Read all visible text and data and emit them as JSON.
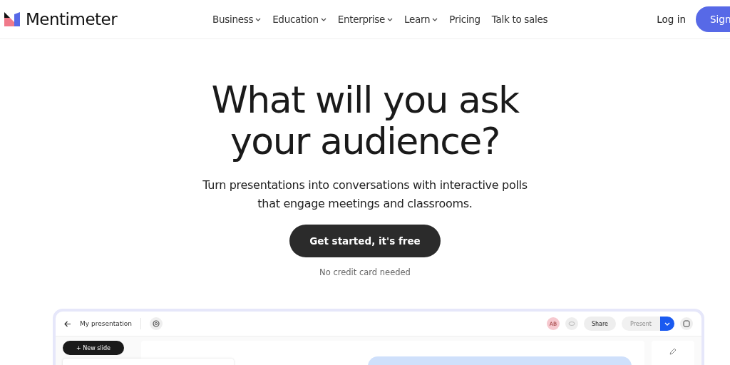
{
  "brand": {
    "name": "Mentimeter"
  },
  "nav": [
    {
      "label": "Business",
      "dropdown": true
    },
    {
      "label": "Education",
      "dropdown": true
    },
    {
      "label": "Enterprise",
      "dropdown": true
    },
    {
      "label": "Learn",
      "dropdown": true
    },
    {
      "label": "Pricing",
      "dropdown": false
    },
    {
      "label": "Talk to sales",
      "dropdown": false
    }
  ],
  "login": "Log in",
  "signup": "Sign",
  "hero": {
    "title_lines": [
      "What will you ask",
      "your audience?"
    ],
    "subtitle_lines": [
      "Turn presentations into conversations with interactive polls",
      "that engage meetings and classrooms."
    ],
    "cta": "Get started, it's free",
    "note": "No credit card needed"
  },
  "editor": {
    "title": "My presentation",
    "avatar": "AB",
    "share": "Share",
    "present": "Present",
    "new_slide": "+ New slide"
  }
}
